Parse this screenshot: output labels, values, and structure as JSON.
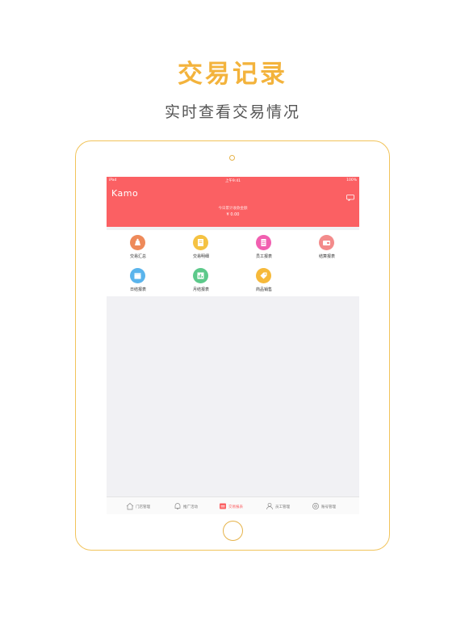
{
  "promo": {
    "headline": "交易记录",
    "subline": "实时查看交易情况"
  },
  "status_bar": {
    "carrier": "iPad",
    "time": "上午9:41",
    "battery": "100%"
  },
  "app": {
    "brand": "Kamo",
    "message_icon": "message-icon",
    "summary_caption": "今日累计收款金额",
    "summary_amount": "¥ 0.00"
  },
  "menu": [
    {
      "label": "交易汇总",
      "icon": "money-bag-icon",
      "color": "#ee8a5a"
    },
    {
      "label": "交易明细",
      "icon": "receipt-icon",
      "color": "#f5c242"
    },
    {
      "label": "员工报表",
      "icon": "document-icon",
      "color": "#f15fb0"
    },
    {
      "label": "结算报表",
      "icon": "wallet-icon",
      "color": "#f38b8b"
    },
    {
      "label": "日结报表",
      "icon": "calendar-icon",
      "color": "#5ab4ec"
    },
    {
      "label": "月结报表",
      "icon": "chart-icon",
      "color": "#5cc98a"
    },
    {
      "label": "商品销售",
      "icon": "tag-icon",
      "color": "#f6b93a"
    }
  ],
  "tabs": [
    {
      "label": "门店管理",
      "icon": "home-icon",
      "active": false
    },
    {
      "label": "推广活动",
      "icon": "bell-icon",
      "active": false
    },
    {
      "label": "交易报表",
      "icon": "report-icon",
      "active": true
    },
    {
      "label": "员工管理",
      "icon": "person-icon",
      "active": false
    },
    {
      "label": "账号管理",
      "icon": "settings-icon",
      "active": false
    }
  ],
  "colors": {
    "accent": "#fb6063",
    "promo": "#f3b33c",
    "frame": "#f1c35a"
  }
}
